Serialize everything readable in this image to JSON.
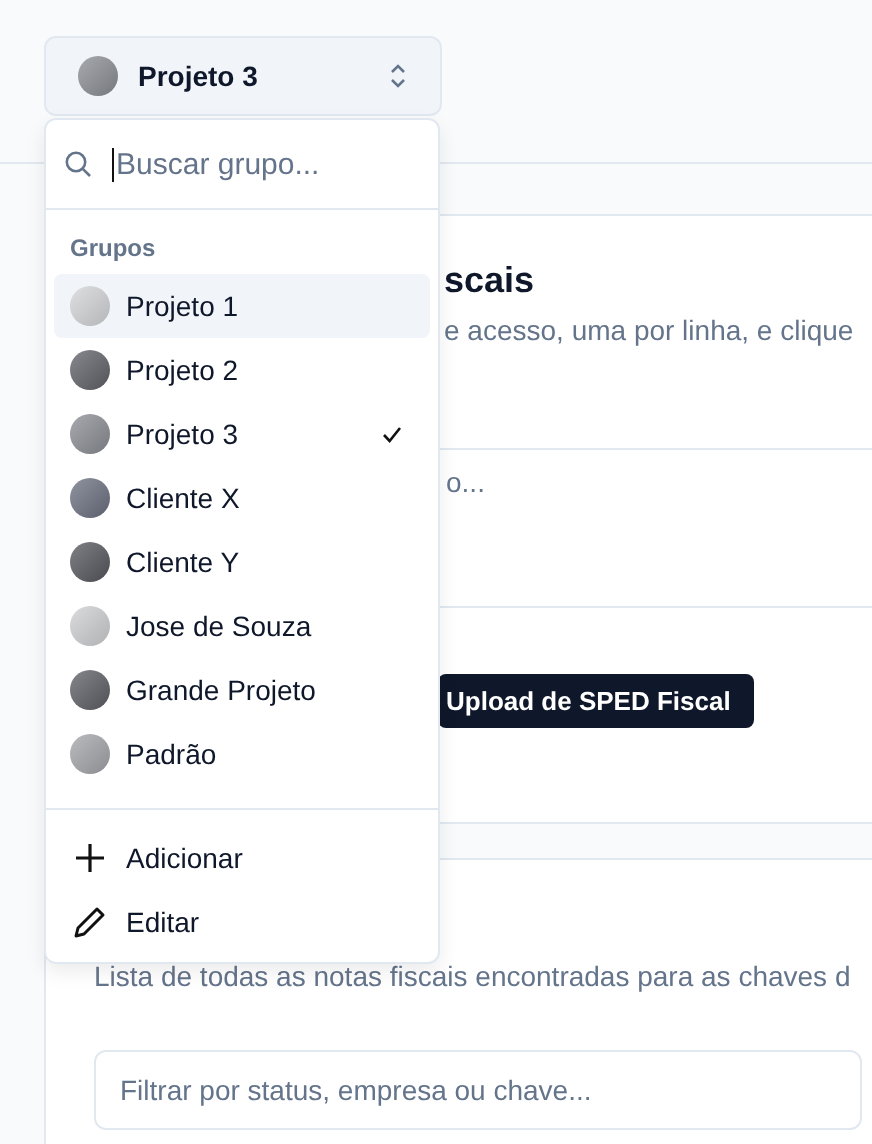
{
  "group_selector": {
    "label": "Projeto 3",
    "color": "#8a8d94"
  },
  "dropdown": {
    "search": {
      "placeholder": "Buscar grupo..."
    },
    "section_label": "Grupos",
    "items": [
      {
        "label": "Projeto 1",
        "color": "#d4d5d8",
        "selected": false,
        "hovered": true
      },
      {
        "label": "Projeto 2",
        "color": "#5f6168",
        "selected": false,
        "hovered": false
      },
      {
        "label": "Projeto 3",
        "color": "#8a8d94",
        "selected": true,
        "hovered": false
      },
      {
        "label": "Cliente X",
        "color": "#6b7080",
        "selected": false,
        "hovered": false
      },
      {
        "label": "Cliente Y",
        "color": "#55575d",
        "selected": false,
        "hovered": false
      },
      {
        "label": "Jose de Souza",
        "color": "#cfd0d3",
        "selected": false,
        "hovered": false
      },
      {
        "label": "Grande Projeto",
        "color": "#5c5e64",
        "selected": false,
        "hovered": false
      },
      {
        "label": "Padrão",
        "color": "#a3a5aa",
        "selected": false,
        "hovered": false
      }
    ],
    "actions": [
      {
        "kind": "add",
        "label": "Adicionar"
      },
      {
        "kind": "edit",
        "label": "Editar"
      }
    ]
  },
  "card_1": {
    "title_fragment": "scais",
    "description_fragment": "e acesso, uma por linha, e clique",
    "input_fragment": "o...",
    "upload_button": "Upload de SPED Fiscal"
  },
  "card_2": {
    "description": "Lista de todas as notas fiscais encontradas para as chaves d",
    "filter": {
      "placeholder": "Filtrar por status, empresa ou chave..."
    }
  }
}
